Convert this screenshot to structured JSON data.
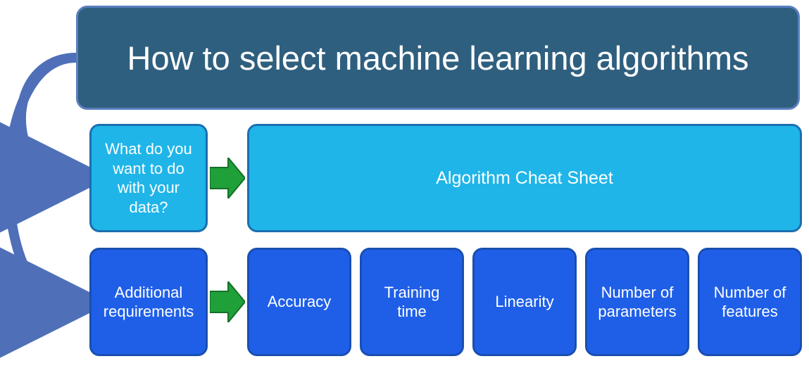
{
  "title": "How to select machine learning algorithms",
  "row2": {
    "question": "What do you want to do with your data?",
    "cheat": "Algorithm Cheat Sheet"
  },
  "row3": {
    "label": "Additional requirements",
    "items": [
      "Accuracy",
      "Training time",
      "Linearity",
      "Number of parameters",
      "Number of features"
    ]
  }
}
